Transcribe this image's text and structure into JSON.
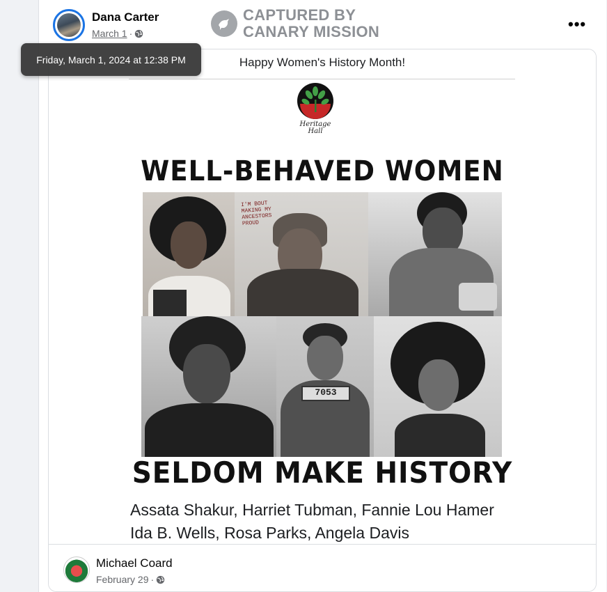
{
  "post": {
    "author": "Dana Carter",
    "date": "March 1",
    "separator": "·",
    "tooltip": "Friday, March 1, 2024 at 12:38 PM",
    "more_label": "•••"
  },
  "watermark": {
    "line1": "CAPTURED BY",
    "line2": "CANARY MISSION"
  },
  "shared_post": {
    "image": {
      "caption": "Happy Women's History Month!",
      "logo_text": "Heritage Hall",
      "headline_top": "WELL-BEHAVED WOMEN",
      "headline_bottom": "SELDOM MAKE HISTORY",
      "sign_text": "I'M BOUT MAKING MY ANCESTORS PROUD",
      "mugshot_number": "7053",
      "names_line1": "Assata Shakur, Harriet Tubman, Fannie Lou Hamer",
      "names_line2": "Ida B. Wells, Rosa Parks, Angela Davis"
    },
    "footer": {
      "author": "Michael Coard",
      "date": "February 29",
      "separator": "·"
    }
  },
  "icons": {
    "globe": "globe-icon",
    "more": "more-options-icon",
    "watermark_logo": "canary-bird-icon"
  },
  "colors": {
    "avatar_ring": "#1b74e4",
    "text_primary": "#050505",
    "text_secondary": "#65676b",
    "tooltip_bg": "#323232"
  }
}
